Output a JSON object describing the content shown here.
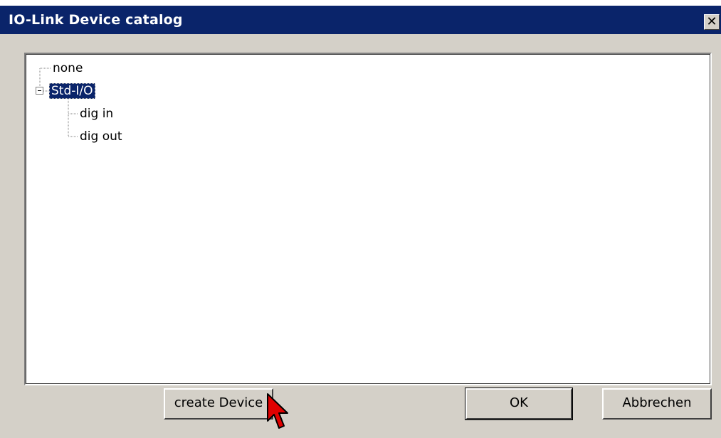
{
  "window": {
    "title": "IO-Link Device catalog",
    "close_glyph": "✕"
  },
  "tree": {
    "nodes": [
      {
        "label": "none",
        "level": 0,
        "selected": false
      },
      {
        "label": "Std-I/O",
        "level": 0,
        "selected": true,
        "expanded": true
      },
      {
        "label": "dig in",
        "level": 1,
        "selected": false
      },
      {
        "label": "dig out",
        "level": 1,
        "selected": false
      }
    ]
  },
  "buttons": {
    "create_device": "create Device",
    "ok": "OK",
    "cancel": "Abbrechen"
  },
  "colors": {
    "titlebar": "#0a246a",
    "face": "#d4d0c8",
    "selection": "#0a246a",
    "cursor": "#e00000"
  },
  "icons": {
    "close": "close-icon",
    "expander": "minus-box-icon",
    "cursor": "mouse-pointer-icon"
  }
}
